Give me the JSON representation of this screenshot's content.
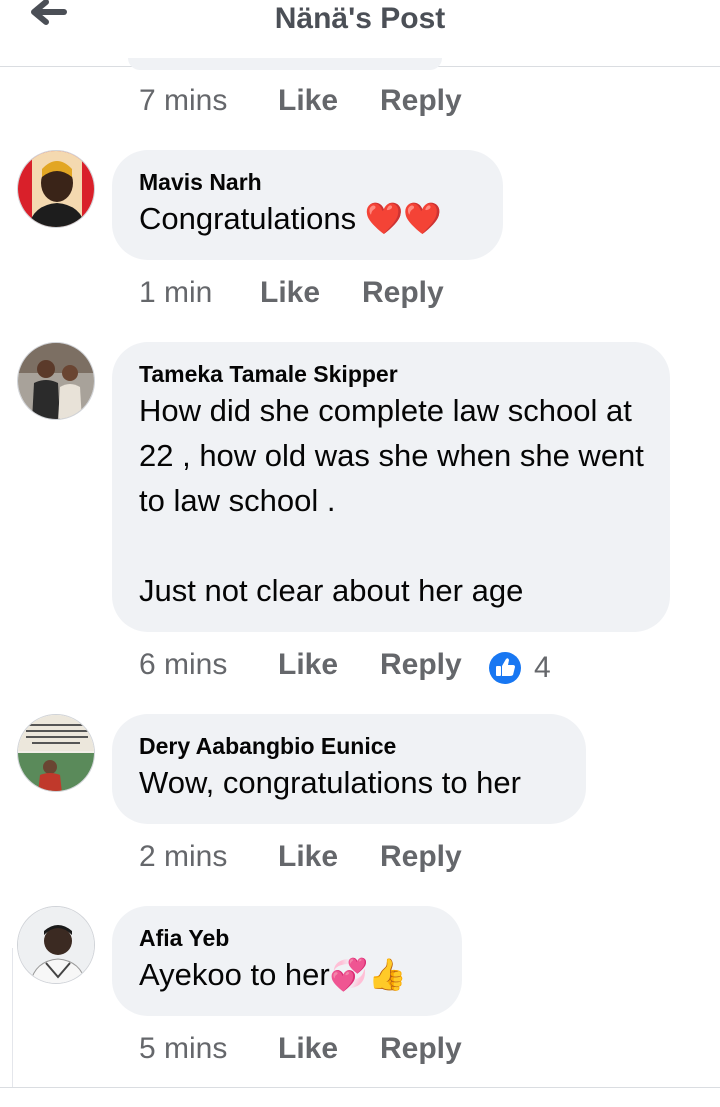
{
  "header": {
    "title": "Nänä's Post"
  },
  "prev": {
    "time": "7 mins",
    "like": "Like",
    "reply": "Reply"
  },
  "comments": [
    {
      "name": "Mavis Narh",
      "text": "Congratulations ❤️❤️",
      "time": "1 min",
      "like": "Like",
      "reply": "Reply"
    },
    {
      "name": "Tameka Tamale Skipper",
      "text": "How did she complete law school at 22 , how old was she when she went to law school .\n\nJust not clear about her age",
      "time": "6 mins",
      "like": "Like",
      "reply": "Reply",
      "reaction_count": "4"
    },
    {
      "name": "Dery Aabangbio Eunice",
      "text": "Wow, congratulations to her",
      "time": "2 mins",
      "like": "Like",
      "reply": "Reply"
    },
    {
      "name": "Afia Yeb",
      "text": "Ayekoo to her💞👍",
      "time": "5 mins",
      "like": "Like",
      "reply": "Reply"
    }
  ],
  "colors": {
    "bubble": "#f0f2f5",
    "meta": "#65676b",
    "like_blue": "#1877f2"
  },
  "icons": {
    "back": "arrow-left-icon",
    "reaction": "thumbs-up-icon"
  }
}
